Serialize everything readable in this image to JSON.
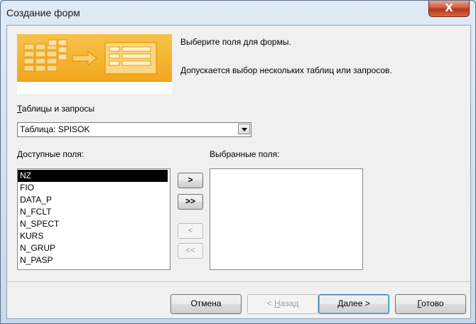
{
  "window": {
    "title": "Создание форм",
    "close_glyph": "X"
  },
  "intro": {
    "line1": "Выберите поля для формы.",
    "line2": "Допускается выбор нескольких таблиц или запросов."
  },
  "tables": {
    "label_u": "Т",
    "label_rest": "аблицы и запросы",
    "selected": "Таблица: SPISOK"
  },
  "available": {
    "label_u": "Д",
    "label_rest": "оступные поля:",
    "items": [
      "NZ",
      "FIO",
      "DATA_P",
      "N_FCLT",
      "N_SPECT",
      "KURS",
      "N_GRUP",
      "N_PASP"
    ],
    "selected_index": 0
  },
  "chosen": {
    "label": "Выбранные поля:"
  },
  "move": {
    "one": ">",
    "all": ">>",
    "back_one": "<",
    "back_all": "<<"
  },
  "buttons": {
    "cancel": "Отмена",
    "back_prefix": "< ",
    "back_u": "Н",
    "back_rest": "азад",
    "next_u": "Д",
    "next_rest": "алее >",
    "finish_u": "Г",
    "finish_rest": "отово"
  },
  "colors": {
    "selection_bg": "#000000",
    "banner": "#f2a71e"
  }
}
